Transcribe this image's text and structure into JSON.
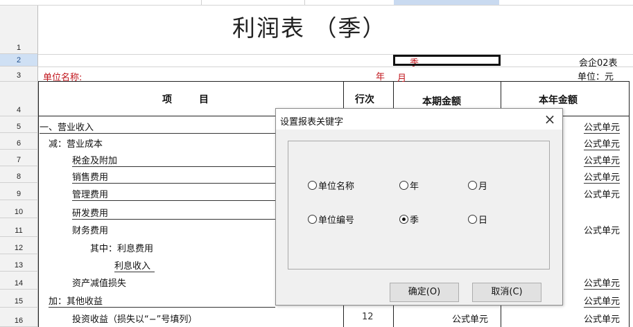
{
  "sheet": {
    "title": "利润表  （季）",
    "season_value": "季",
    "form_code": "会企02表",
    "company_label": "单位名称:",
    "year_label": "年",
    "month_label": "月",
    "unit_label": "单位：元",
    "col_item": "项        目",
    "col_line": "行次",
    "col_current": "本期金额",
    "col_year": "本年金额",
    "row_numbers": [
      "1",
      "2",
      "3",
      "4",
      "5",
      "6",
      "7",
      "8",
      "9",
      "10",
      "11",
      "12",
      "13",
      "14",
      "15",
      "16"
    ],
    "items": [
      "一、营业收入",
      "减：营业成本",
      "税金及附加",
      "销售费用",
      "管理费用",
      "研发费用",
      "财务费用",
      "其中：利息费用",
      "利息收入",
      "资产减值损失",
      "加：其他收益",
      "投资收益（损失以“−”号填列）"
    ],
    "formula_label": "公式单元",
    "row16_line_no": "12",
    "row16_current": "公式单元"
  },
  "dialog": {
    "title": "设置报表关键字",
    "close_glyph": "×",
    "options": {
      "company_name": "单位名称",
      "year": "年",
      "month": "月",
      "company_code": "单位编号",
      "season": "季",
      "day": "日"
    },
    "selected": "season",
    "ok_label": "确定(O)",
    "cancel_label": "取消(C)"
  }
}
